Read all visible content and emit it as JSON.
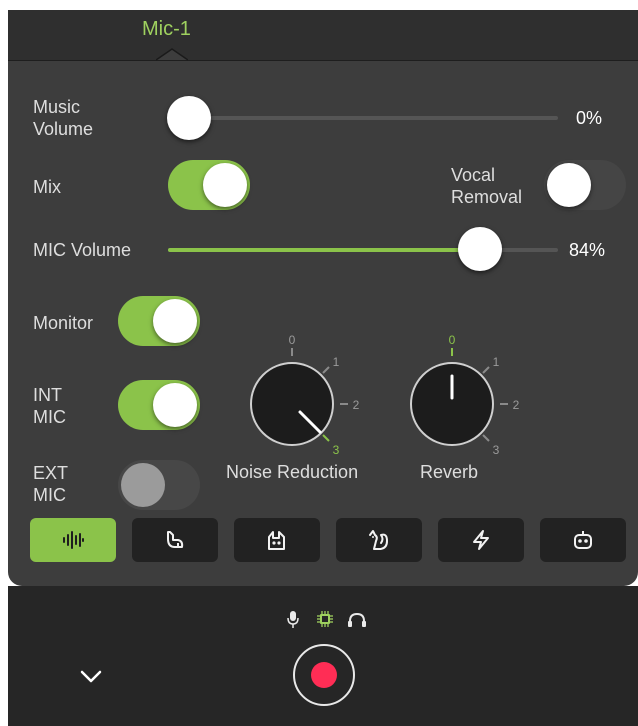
{
  "header": {
    "tab_label": "Mic-1"
  },
  "music_volume": {
    "label_line1": "Music",
    "label_line2": "Volume",
    "value": 0,
    "value_text": "0%"
  },
  "mix": {
    "label": "Mix",
    "on": true
  },
  "vocal_removal": {
    "label_line1": "Vocal",
    "label_line2": "Removal",
    "on": false
  },
  "mic_volume": {
    "label": "MIC Volume",
    "value": 84,
    "value_text": "84%"
  },
  "monitor": {
    "label": "Monitor",
    "on": true
  },
  "int_mic": {
    "label_line1": "INT",
    "label_line2": "MIC",
    "on": true
  },
  "ext_mic": {
    "label_line1": "EXT",
    "label_line2": "MIC",
    "on": false
  },
  "noise_reduction": {
    "label": "Noise Reduction",
    "value": 3,
    "ticks": [
      "0",
      "1",
      "2",
      "3"
    ]
  },
  "reverb": {
    "label": "Reverb",
    "value": 0,
    "ticks": [
      "0",
      "1",
      "2",
      "3"
    ]
  },
  "effects": [
    {
      "icon": "waveform-icon",
      "active": true
    },
    {
      "icon": "cat-icon",
      "active": false
    },
    {
      "icon": "cat-face-icon",
      "active": false
    },
    {
      "icon": "squirrel-icon",
      "active": false
    },
    {
      "icon": "lightning-icon",
      "active": false
    },
    {
      "icon": "robot-icon",
      "active": false
    }
  ],
  "status_icons": [
    "microphone-icon",
    "chip-icon",
    "headphones-icon"
  ],
  "colors": {
    "accent": "#8bc34a",
    "record": "#ff2d55",
    "panel": "#3d3d3d",
    "bottom_bar": "#262626"
  }
}
